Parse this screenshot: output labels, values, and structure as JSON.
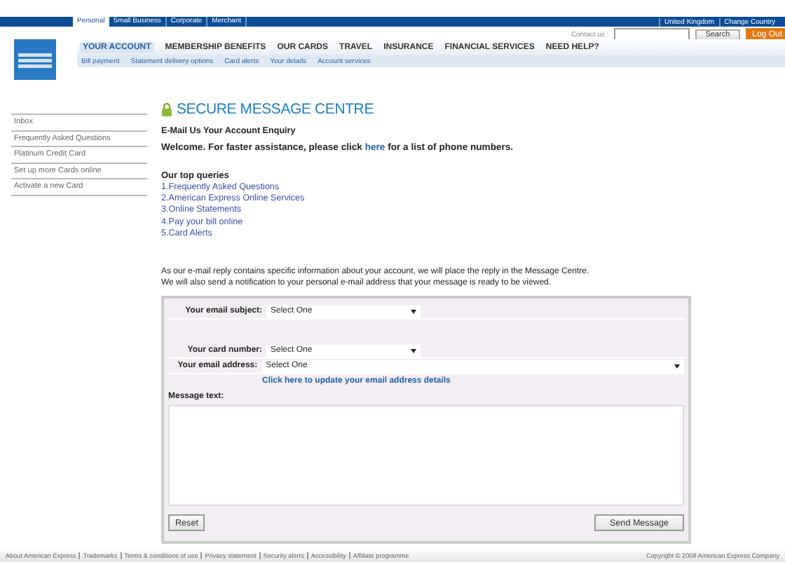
{
  "top_bar": {
    "segments": [
      {
        "label": "Personal",
        "selected": true
      },
      {
        "label": "Small Business",
        "selected": false
      },
      {
        "label": "Corporate",
        "selected": false
      },
      {
        "label": "Merchant",
        "selected": false
      }
    ],
    "region_links": [
      "United Kingdom",
      "Change Country"
    ]
  },
  "utility": {
    "contact_label": "Contact us :",
    "search_button": "Search",
    "logout_button": "Log Out"
  },
  "main_nav": [
    {
      "label": "YOUR ACCOUNT",
      "selected": true
    },
    {
      "label": "MEMBERSHIP BENEFITS",
      "selected": false
    },
    {
      "label": "OUR CARDS",
      "selected": false
    },
    {
      "label": "TRAVEL",
      "selected": false
    },
    {
      "label": "INSURANCE",
      "selected": false
    },
    {
      "label": "FINANCIAL SERVICES",
      "selected": false
    },
    {
      "label": "NEED HELP?",
      "selected": false
    }
  ],
  "sub_nav": [
    "Bill payment",
    "Statement delivery options",
    "Card alerts",
    "Your details",
    "Account services"
  ],
  "sidebar": {
    "items": [
      "Inbox",
      "Frequently Asked Questions",
      "Platinum Credit Card",
      "Set up more Cards online",
      "Activate a new Card"
    ]
  },
  "page": {
    "title": "SECURE MESSAGE CENTRE",
    "subtitle": "E-Mail Us Your Account Enquiry",
    "welcome_before": "Welcome. For faster assistance, please click",
    "welcome_link": "here",
    "welcome_after": "for a list of phone numbers.",
    "queries_heading": "Our top queries",
    "queries": [
      "1.Frequently Asked Questions",
      "2.American Express Online Services",
      "3.Online Statements",
      "4.Pay your bill online",
      "5.Card Alerts"
    ],
    "notice": [
      "As our e-mail reply contains specific information about your account, we will place the reply in the Message Centre.",
      "We will also send a notification to your personal e-mail address that your message is ready to be viewed."
    ]
  },
  "form": {
    "fields": [
      {
        "label": "Your email subject:",
        "value": "Select One",
        "kind": "short"
      },
      {
        "label": "Your card number:",
        "value": "Select One",
        "kind": "short"
      },
      {
        "label": "Your email address:",
        "value": "Select One",
        "kind": "wide"
      }
    ],
    "update_link": "Click here to update your email address details",
    "message_label": "Message text:",
    "reset_button": "Reset",
    "send_button": "Send Message"
  },
  "footer": {
    "links": [
      "About American Express",
      "Trademarks",
      "Terms & conditions of use",
      "Privacy statement",
      "Security alerts",
      "Accessibility",
      "Affiliate programme"
    ],
    "copyright": "Copyright © 2008 American Express Company"
  }
}
